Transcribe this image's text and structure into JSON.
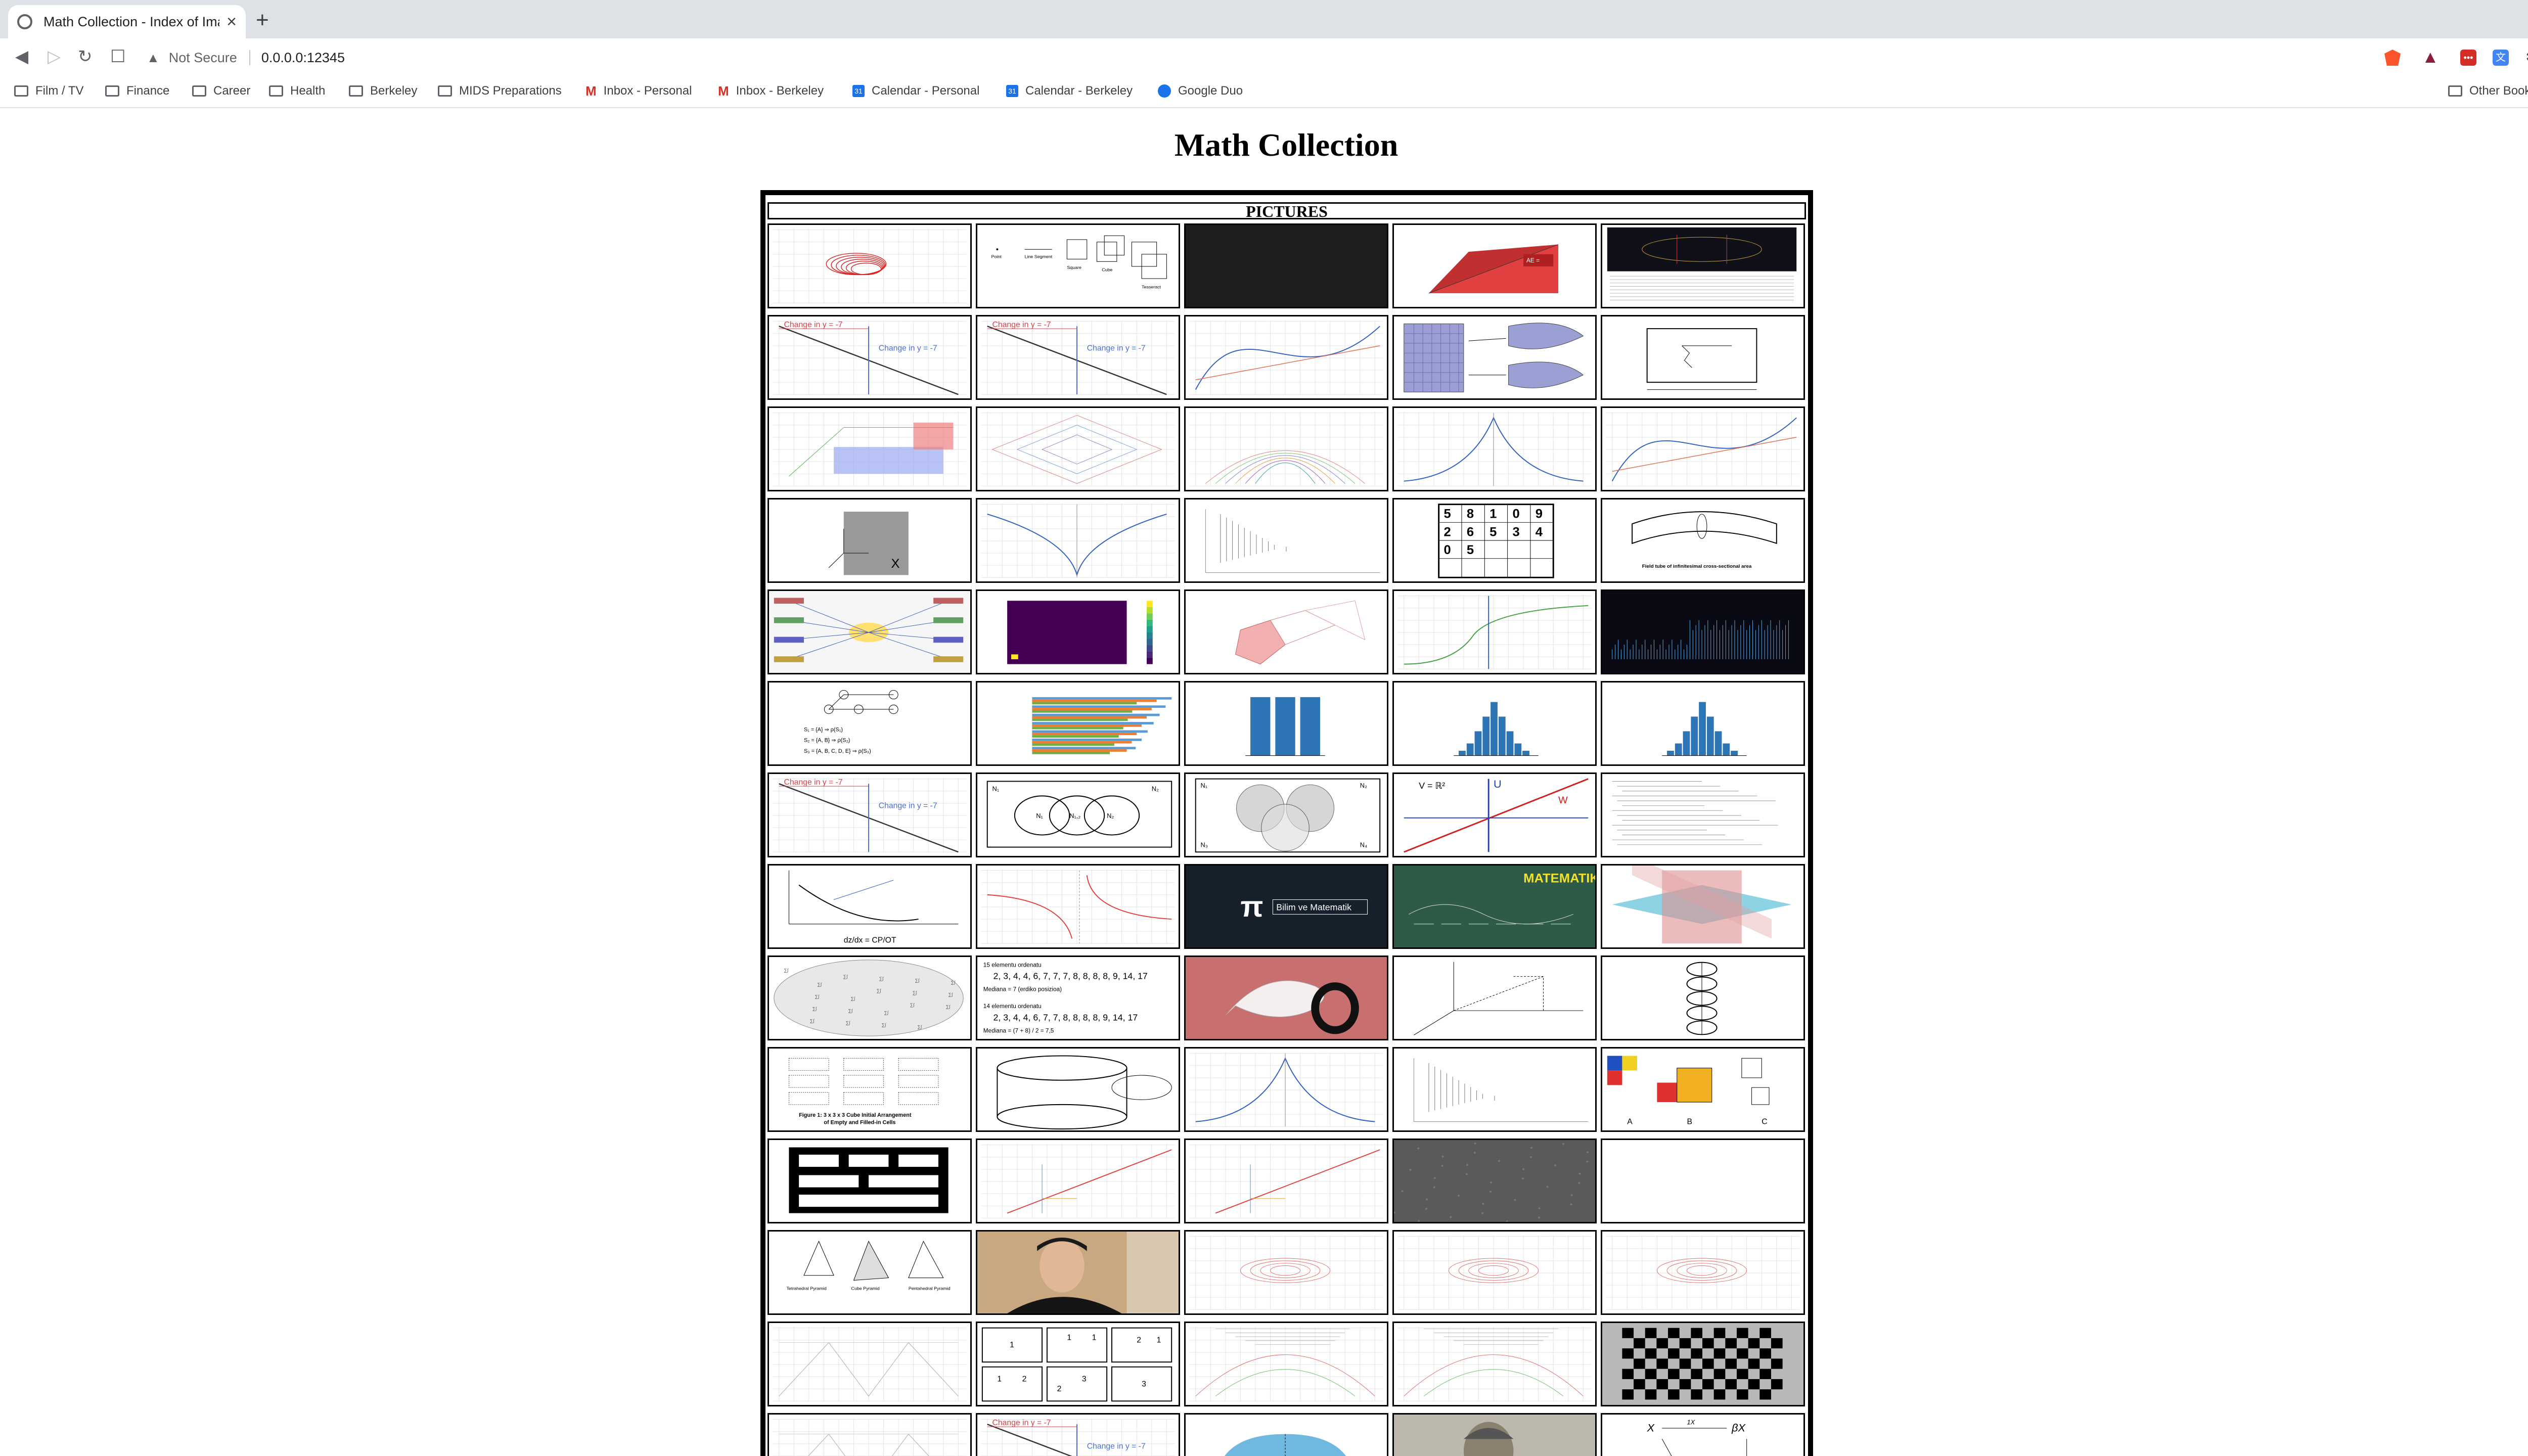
{
  "browser": {
    "tab_title": "Math Collection - Index of Imag",
    "tab_close": "×",
    "new_tab": "+",
    "security_label": "Not Secure",
    "url": "0.0.0.0:12345",
    "icons": {
      "back": "◀",
      "forward": "▷",
      "reload": "↻",
      "bookmark": "☐",
      "warning": "▲",
      "menu": "⋮",
      "puzzle": "✱",
      "translate": "文",
      "lastpass": "•••",
      "triangle": "▲"
    },
    "bookmarks": [
      {
        "label": "Film / TV",
        "icon": "folder-icon"
      },
      {
        "label": "Finance",
        "icon": "folder-icon"
      },
      {
        "label": "Career",
        "icon": "folder-icon"
      },
      {
        "label": "Health",
        "icon": "folder-icon"
      },
      {
        "label": "Berkeley",
        "icon": "folder-icon"
      },
      {
        "label": "MIDS Preparations",
        "icon": "folder-icon"
      },
      {
        "label": "Inbox - Personal",
        "icon": "gmail-icon"
      },
      {
        "label": "Inbox - Berkeley",
        "icon": "gmail-icon"
      },
      {
        "label": "Calendar - Personal",
        "icon": "calendar-icon"
      },
      {
        "label": "Calendar - Berkeley",
        "icon": "calendar-icon"
      },
      {
        "label": "Google Duo",
        "icon": "duo-icon"
      }
    ],
    "other_bookmarks": "Other Bookmarks"
  },
  "page": {
    "title": "Math Collection",
    "gallery_header": "PICTURES"
  },
  "gallery": {
    "rows": [
      [
        {
          "kind": "attractor"
        },
        {
          "kind": "cubes",
          "labels": [
            "Point",
            "Line Segment",
            "Square",
            "Cube",
            "Tesseract"
          ]
        },
        {
          "kind": "dark"
        },
        {
          "kind": "reddiag",
          "labels": [
            "AE ="
          ]
        },
        {
          "kind": "darkbox"
        }
      ],
      [
        {
          "kind": "slope",
          "labels": [
            "Change in y = -7"
          ]
        },
        {
          "kind": "slope",
          "labels": [
            "Change in y = -7"
          ]
        },
        {
          "kind": "cubic"
        },
        {
          "kind": "mapping"
        },
        {
          "kind": "rectdiag"
        }
      ],
      [
        {
          "kind": "planes"
        },
        {
          "kind": "diamond"
        },
        {
          "kind": "contour"
        },
        {
          "kind": "cusp"
        },
        {
          "kind": "cubic"
        }
      ],
      [
        {
          "kind": "graysq",
          "labels": [
            "X"
          ]
        },
        {
          "kind": "vcurve"
        },
        {
          "kind": "decay"
        },
        {
          "kind": "sudoku",
          "labels": [
            "5",
            "8",
            "1",
            "0",
            "9",
            "2",
            "6",
            "5",
            "3",
            "4",
            "0",
            "5"
          ]
        },
        {
          "kind": "tube",
          "labels": [
            "Field tube of infinitesimal cross-sectional area"
          ]
        }
      ],
      [
        {
          "kind": "mindmap"
        },
        {
          "kind": "heatmap"
        },
        {
          "kind": "pinkshapes"
        },
        {
          "kind": "tangent"
        },
        {
          "kind": "signal"
        }
      ],
      [
        {
          "kind": "graphnet",
          "labels": [
            "S₁ = {A} ⇒ ρ(S₁)",
            "S₂ = {A, B} ⇒ ρ(S₂)",
            "S₃ = {A, B, C, D, E} ⇒ ρ(S₃)"
          ]
        },
        {
          "kind": "hbars"
        },
        {
          "kind": "bars3"
        },
        {
          "kind": "hist"
        },
        {
          "kind": "hist"
        }
      ],
      [
        {
          "kind": "slope",
          "labels": [
            "Change in y = -7"
          ]
        },
        {
          "kind": "venn3",
          "labels": [
            "N₁",
            "N₂",
            "N₁,₂",
            "N₂",
            "N₁"
          ]
        },
        {
          "kind": "venn4",
          "labels": [
            "N₁",
            "N₂",
            "N₃",
            "N₄"
          ]
        },
        {
          "kind": "redline",
          "labels": [
            "V = ℝ²",
            "U",
            "W"
          ]
        },
        {
          "kind": "textpage"
        }
      ],
      [
        {
          "kind": "curvearrow",
          "labels": [
            "dz/dx = CP/OT"
          ]
        },
        {
          "kind": "hyperbola"
        },
        {
          "kind": "pi",
          "labels": [
            "π",
            "Bilim ve Matematik"
          ]
        },
        {
          "kind": "chalk",
          "labels": [
            "MATEMATIKA"
          ]
        },
        {
          "kind": "xplanes"
        }
      ],
      [
        {
          "kind": "globe"
        },
        {
          "kind": "median",
          "labels": [
            "15 elementu ordenatu",
            "2, 3, 4, 4, 6, 7, 7, 7, 8, 8, 8, 8, 9, 14, 17",
            "Mediana = 7 (erdiko posizioa)",
            "14 elementu ordenatu",
            "2, 3, 4, 4, 6, 7, 7, 8, 8, 8, 8, 9, 14, 17",
            "Mediana = (7 + 8) / 2 = 7,5"
          ]
        },
        {
          "kind": "mobius"
        },
        {
          "kind": "axes3d"
        },
        {
          "kind": "helix"
        }
      ],
      [
        {
          "kind": "cubegrid",
          "labels": [
            "Figure 1: 3 x 3 x 3 Cube Initial Arrangement",
            "of Empty and Filled-in Cells"
          ]
        },
        {
          "kind": "cylinder"
        },
        {
          "kind": "cusp"
        },
        {
          "kind": "decay"
        },
        {
          "kind": "colorcubes",
          "labels": [
            "A",
            "B",
            "C"
          ]
        }
      ],
      [
        {
          "kind": "blackframe"
        },
        {
          "kind": "redline2"
        },
        {
          "kind": "redline2"
        },
        {
          "kind": "concrete"
        },
        {
          "kind": "blank"
        }
      ],
      [
        {
          "kind": "pyramids",
          "labels": [
            "Tetrahedral Pyramid",
            "Cube Pyramid",
            "Pentahedral Pyramid"
          ]
        },
        {
          "kind": "photo"
        },
        {
          "kind": "spiral"
        },
        {
          "kind": "spiral"
        },
        {
          "kind": "spiral"
        }
      ],
      [
        {
          "kind": "wire"
        },
        {
          "kind": "partitions",
          "labels": [
            "1",
            "1",
            "1",
            "2",
            "1",
            "1",
            "2",
            "2",
            "3",
            "3"
          ]
        },
        {
          "kind": "arcs"
        },
        {
          "kind": "arcs"
        },
        {
          "kind": "checker"
        }
      ],
      [
        {
          "kind": "wire"
        },
        {
          "kind": "slope",
          "labels": [
            "Change in y = -7"
          ]
        },
        {
          "kind": "hemisphere"
        },
        {
          "kind": "portrait"
        },
        {
          "kind": "commdiag",
          "labels": [
            "X",
            "βX",
            "1X"
          ]
        }
      ]
    ]
  }
}
